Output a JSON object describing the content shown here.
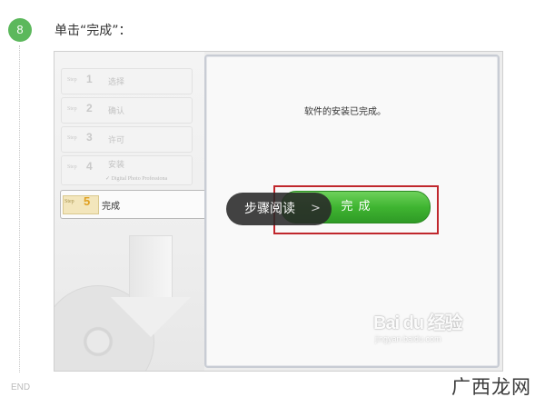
{
  "step": {
    "number": "8",
    "instruction": "单击“完成”："
  },
  "installer": {
    "steps": [
      {
        "word": "Step",
        "num": "1",
        "label": "选择"
      },
      {
        "word": "Step",
        "num": "2",
        "label": "确认"
      },
      {
        "word": "Step",
        "num": "3",
        "label": "许可"
      },
      {
        "word": "Step",
        "num": "4",
        "label": "安装"
      }
    ],
    "step4_sub": "✓ Digital Photo Professiona",
    "current_step": {
      "word": "Step",
      "num": "5",
      "label": "完成"
    },
    "complete_message": "软件的安装已完成。",
    "finish_button": "完成"
  },
  "overlay": {
    "tooltip_label": "步骤阅读",
    "tooltip_chevron": ">"
  },
  "watermarks": {
    "baidu_logo": "Bai du 经验",
    "baidu_url": "jingyan.baidu.com",
    "site": "广西龙网"
  },
  "footer": {
    "end_label": "END"
  },
  "colors": {
    "badge": "#5cb85c",
    "finish_button": "#3fb531",
    "highlight": "#c0272d"
  }
}
